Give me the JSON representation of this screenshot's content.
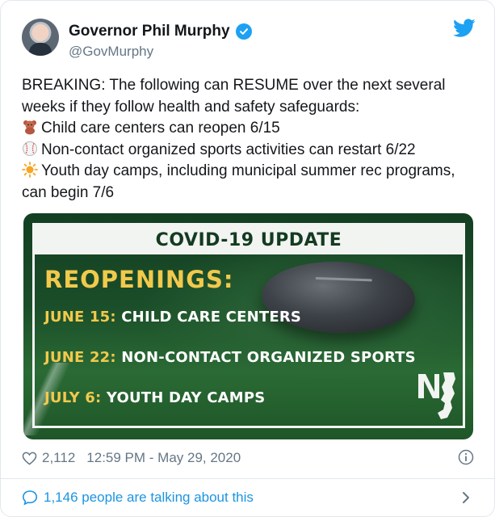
{
  "author": {
    "display_name": "Governor Phil Murphy",
    "handle": "@GovMurphy",
    "verified": true
  },
  "tweet": {
    "lines": [
      {
        "icon": "teddy-bear-icon",
        "text": "BREAKING: The following can RESUME over the next several weeks if they follow health and safety safeguards:"
      },
      {
        "icon": "teddy-bear-icon",
        "text": "Child care centers can reopen 6/15"
      },
      {
        "icon": "baseball-icon",
        "text": "Non-contact organized sports activities can restart 6/22"
      },
      {
        "icon": "sun-icon",
        "text": "Youth day camps, including municipal summer rec programs, can begin 7/6"
      }
    ]
  },
  "media": {
    "title": "COVID-19 UPDATE",
    "heading": "REOPENINGS:",
    "items": [
      {
        "date": "JUNE 15:",
        "text": "CHILD CARE CENTERS"
      },
      {
        "date": "JUNE 22:",
        "text": "NON-CONTACT ORGANIZED SPORTS"
      },
      {
        "date": "JULY 6:",
        "text": "YOUTH DAY CAMPS"
      }
    ],
    "logo_text": "NJ"
  },
  "meta": {
    "likes": "2,112",
    "timestamp": "12:59 PM - May 29, 2020"
  },
  "footer": {
    "talking": "1,146 people are talking about this"
  },
  "colors": {
    "accent": "#1da1f2",
    "link": "#1b95e0",
    "secondary_text": "#657786",
    "banner_green": "#133b20",
    "banner_gold": "#f2c94c"
  }
}
